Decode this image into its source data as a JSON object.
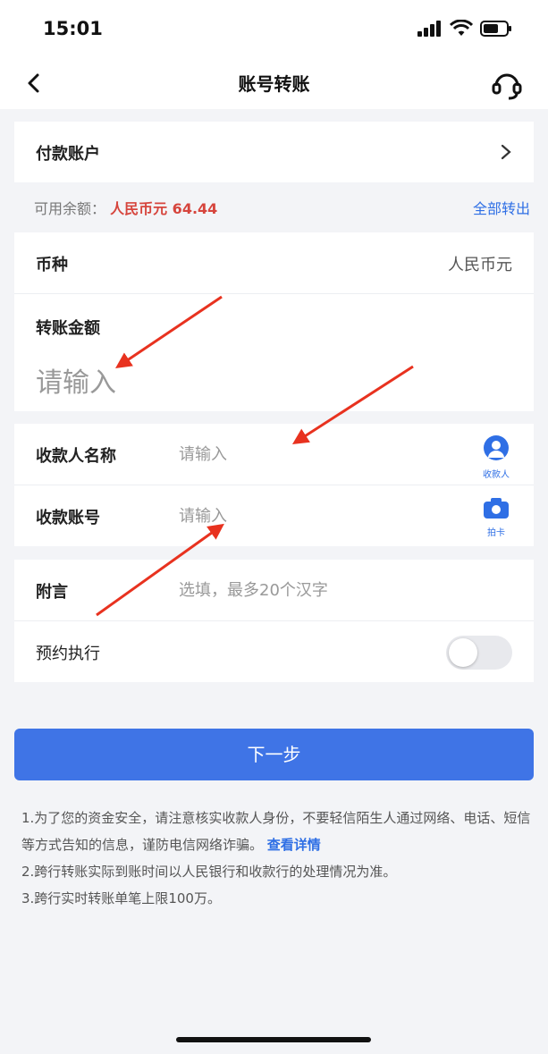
{
  "status": {
    "time": "15:01"
  },
  "nav": {
    "title": "账号转账"
  },
  "payer": {
    "label": "付款账户"
  },
  "balance": {
    "label": "可用余额：",
    "amount": "人民币元 64.44",
    "transfer_all": "全部转出"
  },
  "currency": {
    "label": "币种",
    "value": "人民币元"
  },
  "amount": {
    "label": "转账金额",
    "placeholder": "请输入"
  },
  "payee": {
    "name_label": "收款人名称",
    "name_placeholder": "请输入",
    "name_btn": "收款人",
    "account_label": "收款账号",
    "account_placeholder": "请输入",
    "account_btn": "拍卡"
  },
  "remark": {
    "label": "附言",
    "placeholder": "选填，最多20个汉字"
  },
  "schedule": {
    "label": "预约执行",
    "enabled": false
  },
  "next_button": "下一步",
  "notes": {
    "n1": "1.为了您的资金安全，请注意核实收款人身份，不要轻信陌生人通过网络、电话、短信等方式告知的信息，谨防电信网络诈骗。",
    "n1_link": "查看详情",
    "n2": "2.跨行转账实际到账时间以人民银行和收款行的处理情况为准。",
    "n3": "3.跨行实时转账单笔上限100万。"
  },
  "colors": {
    "accent": "#3f74e6",
    "amount_red": "#d6453d",
    "annotation_arrow": "#e8321f"
  }
}
